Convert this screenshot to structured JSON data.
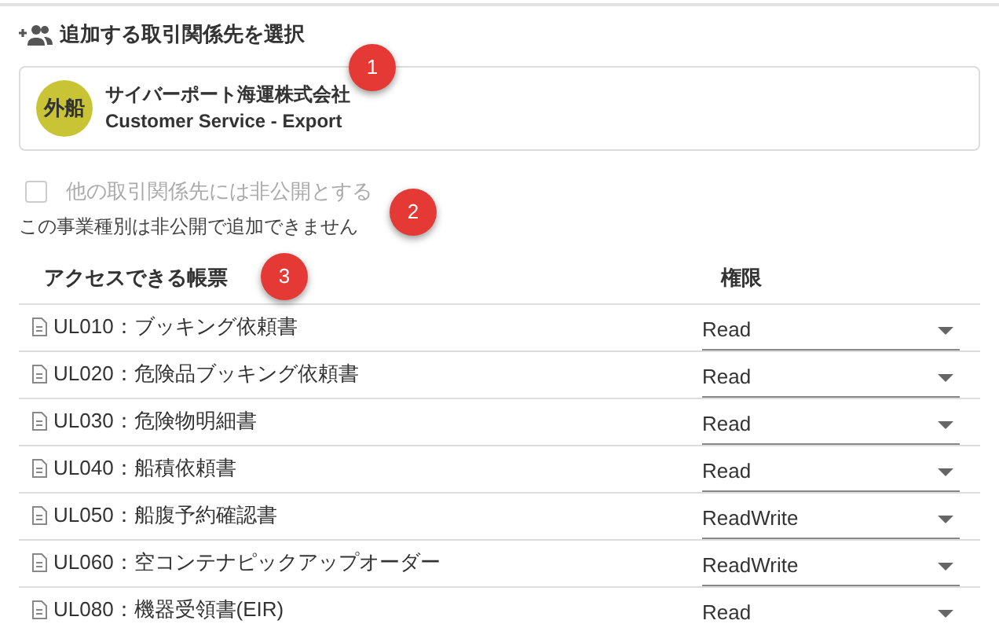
{
  "heading": "追加する取引関係先を選択",
  "partner": {
    "avatar": "外船",
    "color": "#c9c435",
    "name": "サイバーポート海運株式会社",
    "department": "Customer Service - Export"
  },
  "private_option": {
    "label": "他の取引関係先には非公開とする",
    "checked": false,
    "disabled": true,
    "note": "この事業種別は非公開で追加できません"
  },
  "table": {
    "columns": [
      "アクセスできる帳票",
      "権限"
    ],
    "rows": [
      {
        "form": "UL010：ブッキング依頼書",
        "permission": "Read"
      },
      {
        "form": "UL020：危険品ブッキング依頼書",
        "permission": "Read"
      },
      {
        "form": "UL030：危険物明細書",
        "permission": "Read"
      },
      {
        "form": "UL040：船積依頼書",
        "permission": "Read"
      },
      {
        "form": "UL050：船腹予約確認書",
        "permission": "ReadWrite"
      },
      {
        "form": "UL060：空コンテナピックアップオーダー",
        "permission": "ReadWrite"
      },
      {
        "form": "UL080：機器受領書(EIR)",
        "permission": "Read"
      }
    ]
  },
  "markers": [
    "1",
    "2",
    "3"
  ]
}
